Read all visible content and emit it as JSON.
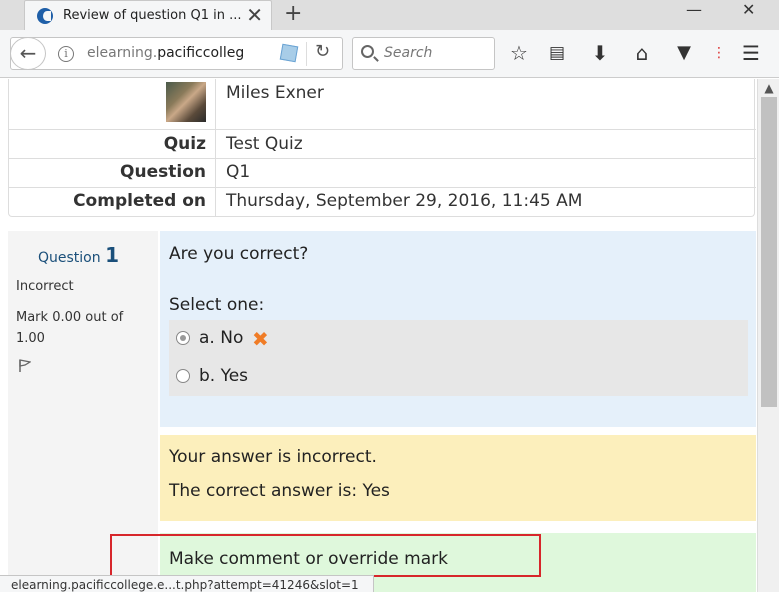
{
  "browser": {
    "tab_title": "Review of question Q1 in ...",
    "tab_close": "✕",
    "new_tab": "+",
    "url_host": "elearning.",
    "url_domain": "pacificcolleg",
    "search_placeholder": "Search",
    "status_url": "elearning.pacificcollege.e...t.php?attempt=41246&slot=1",
    "minimize": "—",
    "close": "✕"
  },
  "summary": {
    "name": "Miles Exner",
    "quiz_label": "Quiz",
    "quiz_value": "Test Quiz",
    "question_label": "Question",
    "question_value": "Q1",
    "completed_label": "Completed on",
    "completed_value": "Thursday, September 29, 2016, 11:45 AM"
  },
  "question": {
    "label": "Question",
    "number": "1",
    "state": "Incorrect",
    "mark": "Mark 0.00 out of 1.00",
    "text": "Are you correct?",
    "prompt": "Select one:",
    "answers": [
      {
        "label": "a. No",
        "checked": true,
        "incorrect": true
      },
      {
        "label": "b. Yes",
        "checked": false,
        "incorrect": false
      }
    ],
    "feedback": "Your answer is incorrect.",
    "correct_answer": "The correct answer is: Yes",
    "comment_link": "Make comment or override mark"
  },
  "colors": {
    "formulation_bg": "#e5f0fa",
    "feedback_bg": "#fcefbc",
    "comment_bg": "#dff8dc",
    "highlight": "#d7262b",
    "incorrect_mark": "#f07c26"
  }
}
